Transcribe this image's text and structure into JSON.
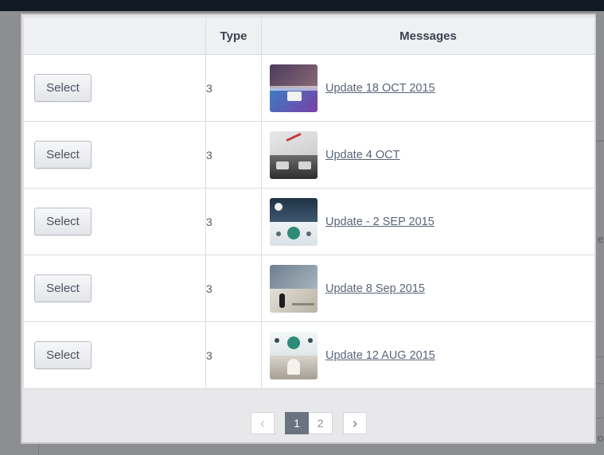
{
  "table": {
    "headers": {
      "select": "",
      "type": "Type",
      "messages": "Messages"
    },
    "rows": [
      {
        "select_label": "Select",
        "type": "3",
        "message": "Update 18 OCT 2015",
        "thumb_colors": [
          "#4b3b5e",
          "#7a3fa6",
          "#3b7fc4"
        ]
      },
      {
        "select_label": "Select",
        "type": "3",
        "message": "Update 4 OCT",
        "thumb_colors": [
          "#d9d9d9",
          "#c23b3b",
          "#3a3a3a"
        ]
      },
      {
        "select_label": "Select",
        "type": "3",
        "message": "Update - 2 SEP 2015",
        "thumb_colors": [
          "#2d4256",
          "#e9eef2",
          "#2e8b78"
        ]
      },
      {
        "select_label": "Select",
        "type": "3",
        "message": "Update 8 Sep 2015",
        "thumb_colors": [
          "#7b8a99",
          "#d8d3c9",
          "#222222"
        ]
      },
      {
        "select_label": "Select",
        "type": "3",
        "message": "Update 12 AUG 2015",
        "thumb_colors": [
          "#e7eef0",
          "#2e8b78",
          "#cfcac4"
        ]
      }
    ]
  },
  "pagination": {
    "prev_icon": "chevron-left-icon",
    "next_icon": "chevron-right-icon",
    "pages": [
      "1",
      "2"
    ],
    "current": "1"
  },
  "background_fragments": {
    "right_text_1": "e",
    "right_text_2": "o"
  },
  "colors": {
    "topbar": "#111a24",
    "active_page": "#6b7280",
    "link": "#5b6577"
  }
}
